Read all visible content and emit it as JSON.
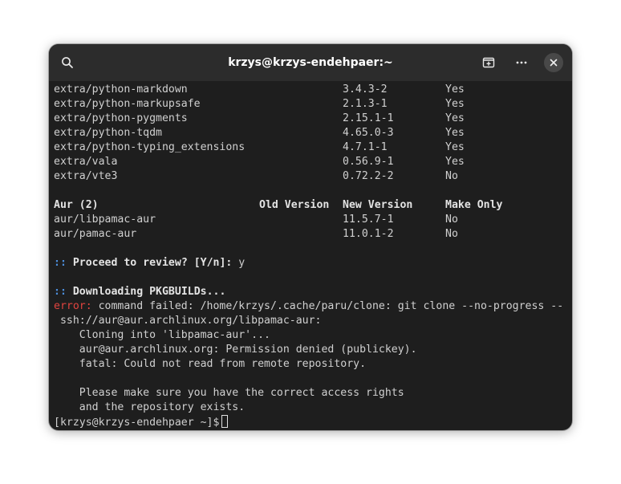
{
  "window": {
    "title": "krzys@krzys-endehpaer:~",
    "icons": {
      "search": "search-icon",
      "new_tab": "new-tab-icon",
      "menu": "ellipsis-icon",
      "close": "close-icon"
    }
  },
  "terminal": {
    "repo_packages": [
      {
        "name": "extra/python-markdown",
        "new_version": "3.4.3-2",
        "make_only": "Yes"
      },
      {
        "name": "extra/python-markupsafe",
        "new_version": "2.1.3-1",
        "make_only": "Yes"
      },
      {
        "name": "extra/python-pygments",
        "new_version": "2.15.1-1",
        "make_only": "Yes"
      },
      {
        "name": "extra/python-tqdm",
        "new_version": "4.65.0-3",
        "make_only": "Yes"
      },
      {
        "name": "extra/python-typing_extensions",
        "new_version": "4.7.1-1",
        "make_only": "Yes"
      },
      {
        "name": "extra/vala",
        "new_version": "0.56.9-1",
        "make_only": "Yes"
      },
      {
        "name": "extra/vte3",
        "new_version": "0.72.2-2",
        "make_only": "No"
      }
    ],
    "aur_header": {
      "label": "Aur (2)",
      "old_version": "Old Version",
      "new_version": "New Version",
      "make_only": "Make Only"
    },
    "aur_packages": [
      {
        "name": "aur/libpamac-aur",
        "new_version": "11.5.7-1",
        "make_only": "No"
      },
      {
        "name": "aur/pamac-aur",
        "new_version": "11.0.1-2",
        "make_only": "No"
      }
    ],
    "prompt_marker": "::",
    "review_prompt": "Proceed to review? [Y/n]:",
    "review_answer": " y",
    "downloading": "Downloading PKGBUILDs...",
    "error_label": "error:",
    "error_message": " command failed: /home/krzys/.cache/paru/clone: git clone --no-progress --",
    "error_lines": [
      " ssh://aur@aur.archlinux.org/libpamac-aur:",
      "    Cloning into 'libpamac-aur'...",
      "    aur@aur.archlinux.org: Permission denied (publickey).",
      "    fatal: Could not read from remote repository.",
      "",
      "    Please make sure you have the correct access rights",
      "    and the repository exists."
    ],
    "shell_prompt": "[krzys@krzys-endehpaer ~]$"
  },
  "colors": {
    "background": "#1e1e1e",
    "titlebar": "#2c2c2c",
    "text": "#d0d0d0",
    "marker_blue": "#4c8dd9",
    "error_red": "#e0443f"
  }
}
